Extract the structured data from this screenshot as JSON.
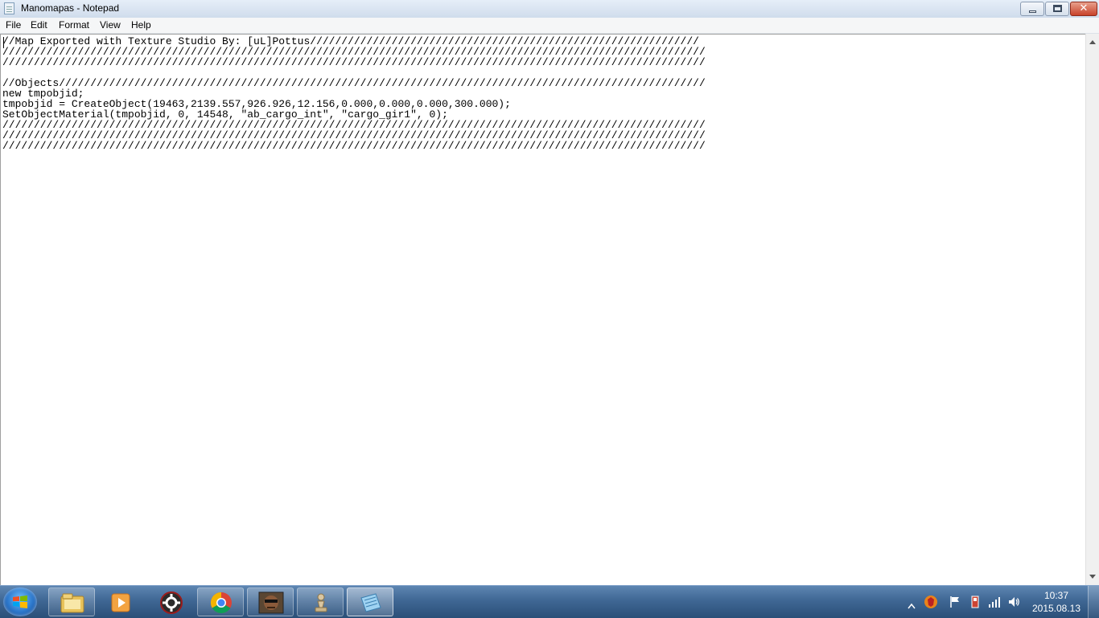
{
  "window": {
    "title": "Manomapas - Notepad",
    "controls": {
      "minimize": "minimize",
      "maximize": "restore",
      "close": "✕"
    }
  },
  "menu": {
    "items": [
      "File",
      "Edit",
      "Format",
      "View",
      "Help"
    ]
  },
  "editor": {
    "lines": [
      "//Map Exported with Texture Studio By: [uL]Pottus//////////////////////////////////////////////////////////////",
      "////////////////////////////////////////////////////////////////////////////////////////////////////////////////",
      "////////////////////////////////////////////////////////////////////////////////////////////////////////////////",
      "",
      "//Objects///////////////////////////////////////////////////////////////////////////////////////////////////////",
      "new tmpobjid;",
      "tmpobjid = CreateObject(19463,2139.557,926.926,12.156,0.000,0.000,0.000,300.000);",
      "SetObjectMaterial(tmpobjid, 0, 14548, \"ab_cargo_int\", \"cargo_gir1\", 0);",
      "////////////////////////////////////////////////////////////////////////////////////////////////////////////////",
      "////////////////////////////////////////////////////////////////////////////////////////////////////////////////",
      "////////////////////////////////////////////////////////////////////////////////////////////////////////////////"
    ]
  },
  "taskbar": {
    "pinned": [
      {
        "icon": "windows-explorer-icon"
      },
      {
        "icon": "media-player-icon"
      },
      {
        "icon": "app-gear-icon"
      },
      {
        "icon": "chrome-icon"
      },
      {
        "icon": "game-character-icon"
      },
      {
        "icon": "chess-pawn-icon"
      },
      {
        "icon": "notepad-icon"
      }
    ],
    "tray_icons": [
      "show-hidden-icons-arrow",
      "antivirus-icon",
      "action-center-flag-icon",
      "usb-device-icon",
      "network-signal-icon",
      "volume-icon"
    ],
    "clock": {
      "time": "10:37",
      "date": "2015.08.13"
    }
  }
}
